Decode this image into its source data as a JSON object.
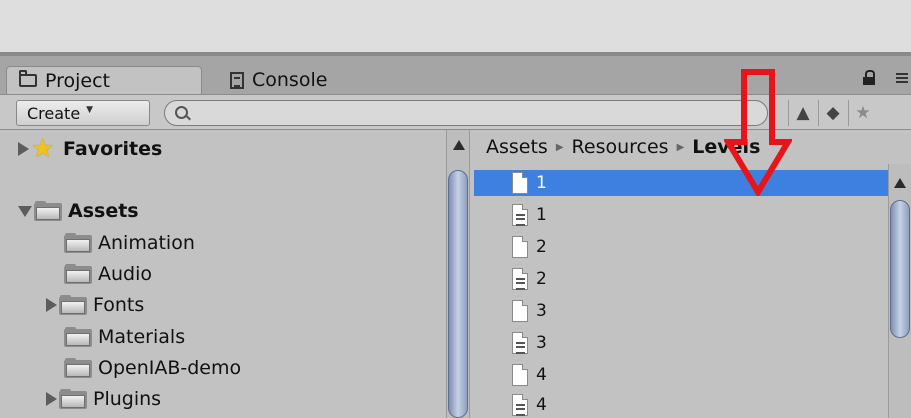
{
  "tabs": [
    {
      "label": "Project",
      "icon": "folder-icon",
      "active": true
    },
    {
      "label": "Console",
      "icon": "console-icon",
      "active": false
    }
  ],
  "toolbar": {
    "create_label": "Create",
    "search_placeholder": "",
    "search_value": ""
  },
  "tree": {
    "favorites": "Favorites",
    "assets": "Assets",
    "items": [
      "Animation",
      "Audio",
      "Fonts",
      "Materials",
      "OpenIAB-demo",
      "Plugins"
    ]
  },
  "breadcrumb": [
    "Assets",
    "Resources",
    "Levels"
  ],
  "files": [
    {
      "name": "1",
      "icon": "blank-file-icon",
      "selected": true
    },
    {
      "name": "1",
      "icon": "text-file-icon",
      "selected": false
    },
    {
      "name": "2",
      "icon": "blank-file-icon",
      "selected": false
    },
    {
      "name": "2",
      "icon": "text-file-icon",
      "selected": false
    },
    {
      "name": "3",
      "icon": "blank-file-icon",
      "selected": false
    },
    {
      "name": "3",
      "icon": "text-file-icon",
      "selected": false
    },
    {
      "name": "4",
      "icon": "blank-file-icon",
      "selected": false
    },
    {
      "name": "4",
      "icon": "text-file-icon",
      "selected": false
    }
  ],
  "colors": {
    "selection": "#3d80df",
    "annotation_arrow": "#e8141c",
    "panel": "#c2c2c2"
  }
}
